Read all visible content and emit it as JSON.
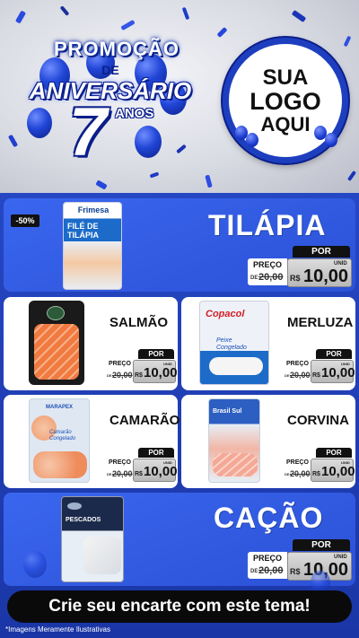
{
  "header": {
    "promo_word": "PROMOÇÃO",
    "de_word": "DE",
    "aniversario_word": "ANIVERSÁRIO",
    "number": "7",
    "anos_word": "ANOS",
    "logo": {
      "line1": "SUA",
      "line2": "LOGO",
      "line3": "AQUI"
    }
  },
  "products": [
    {
      "name": "TILÁPIA",
      "badge": "-50%",
      "package_brand": "Frimesa",
      "package_title": "FILÉ DE TILÁPIA",
      "por_label": "POR",
      "de_label": "PREÇO",
      "de_prefix": "DE",
      "old_price": "20,00",
      "currency": "R$",
      "new_price": "10,00",
      "unit": "UNID"
    },
    {
      "name": "SALMÃO",
      "por_label": "POR",
      "de_label": "PREÇO",
      "de_prefix": "DE",
      "old_price": "20,00",
      "currency": "R$",
      "new_price": "10,00",
      "unit": "UNID"
    },
    {
      "name": "MERLUZA",
      "package_brand": "Copacol",
      "package_title": "Peixe Congelado",
      "por_label": "POR",
      "de_label": "PREÇO",
      "de_prefix": "DE",
      "old_price": "20,00",
      "currency": "R$",
      "new_price": "10,00",
      "unit": "UNID"
    },
    {
      "name": "CAMARÃO",
      "package_brand": "MARAPEX",
      "package_title": "Camarão Congelado",
      "por_label": "POR",
      "de_label": "PREÇO",
      "de_prefix": "DE",
      "old_price": "20,00",
      "currency": "R$",
      "new_price": "10,00",
      "unit": "UNID"
    },
    {
      "name": "CORVINA",
      "package_brand": "Brasil Sul",
      "por_label": "POR",
      "de_label": "PREÇO",
      "de_prefix": "DE",
      "old_price": "20,00",
      "currency": "R$",
      "new_price": "10,00",
      "unit": "UNID"
    },
    {
      "name": "CAÇÃO",
      "package_title": "PESCADOS",
      "por_label": "POR",
      "de_label": "PREÇO",
      "de_prefix": "DE",
      "old_price": "20,00",
      "currency": "R$",
      "new_price": "10,00",
      "unit": "UNID"
    }
  ],
  "cta": "Crie seu encarte com este tema!",
  "disclaimer": "*Imagens Meramente Ilustrativas",
  "colors": {
    "background_blue": "#1e3fa8",
    "card_blue": "#3a66ef",
    "tag_black": "#111111",
    "price_gray": "#c8c8c8"
  }
}
